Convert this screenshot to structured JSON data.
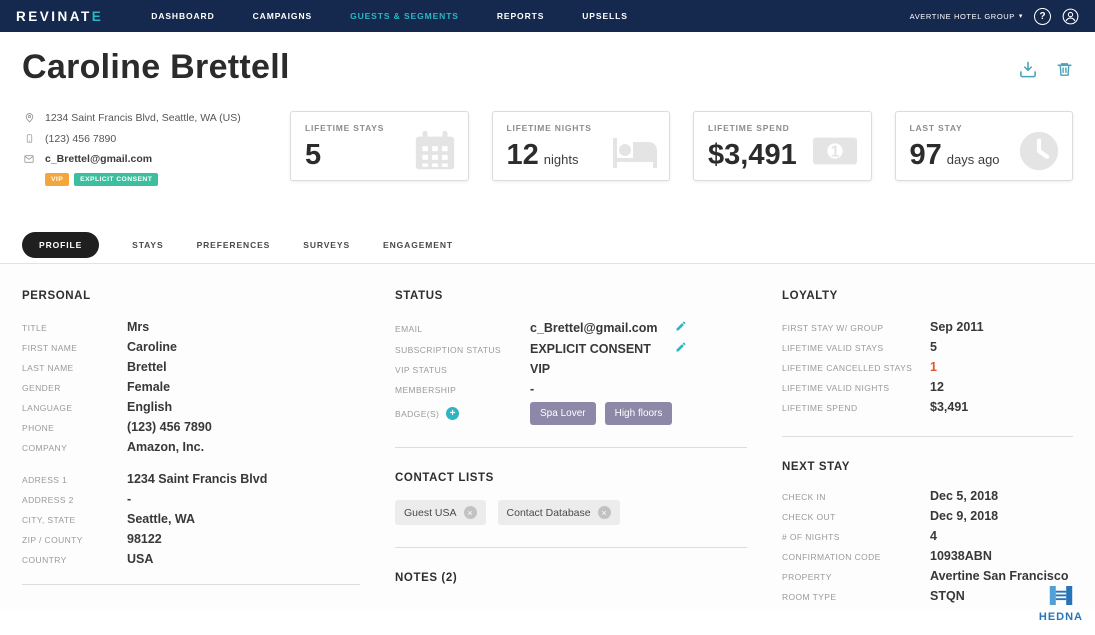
{
  "nav": {
    "logo_main": "REVINAT",
    "logo_accent": "E",
    "items": [
      {
        "label": "DASHBOARD"
      },
      {
        "label": "CAMPAIGNS"
      },
      {
        "label": "GUESTS & SEGMENTS"
      },
      {
        "label": "REPORTS"
      },
      {
        "label": "UPSELLS"
      }
    ],
    "account_label": "AVERTINE HOTEL GROUP",
    "help_icon": "?"
  },
  "header": {
    "title": "Caroline Brettell",
    "address": "1234 Saint Francis Blvd, Seattle, WA (US)",
    "phone": "(123) 456 7890",
    "email": "c_Brettel@gmail.com",
    "vip_badge": "VIP",
    "consent_badge": "EXPLICIT CONSENT"
  },
  "stats": {
    "cards": [
      {
        "label": "LIFETIME STAYS",
        "value": "5",
        "suffix": "",
        "icon": "calendar-icon"
      },
      {
        "label": "LIFETIME NIGHTS",
        "value": "12",
        "suffix": "nights",
        "icon": "bed-icon"
      },
      {
        "label": "LIFETIME SPEND",
        "value": "$3,491",
        "suffix": "",
        "icon": "money-icon"
      },
      {
        "label": "LAST STAY",
        "value": "97",
        "suffix": "days ago",
        "icon": "clock-icon"
      }
    ]
  },
  "tabs": {
    "items": [
      {
        "label": "PROFILE"
      },
      {
        "label": "STAYS"
      },
      {
        "label": "PREFERENCES"
      },
      {
        "label": "SURVEYS"
      },
      {
        "label": "ENGAGEMENT"
      }
    ]
  },
  "personal": {
    "heading": "PERSONAL",
    "rows": [
      {
        "label": "TITLE",
        "value": "Mrs"
      },
      {
        "label": "FIRST NAME",
        "value": "Caroline"
      },
      {
        "label": "LAST NAME",
        "value": "Brettel"
      },
      {
        "label": "GENDER",
        "value": "Female"
      },
      {
        "label": "LANGUAGE",
        "value": "English"
      },
      {
        "label": "PHONE",
        "value": "(123) 456 7890"
      },
      {
        "label": "COMPANY",
        "value": "Amazon, Inc."
      }
    ],
    "address_rows": [
      {
        "label": "ADRESS 1",
        "value": "1234 Saint Francis Blvd"
      },
      {
        "label": "ADDRESS 2",
        "value": "-"
      },
      {
        "label": "CITY, STATE",
        "value": "Seattle, WA"
      },
      {
        "label": "ZIP / COUNTY",
        "value": "98122"
      },
      {
        "label": "COUNTRY",
        "value": "USA"
      }
    ]
  },
  "status": {
    "heading": "STATUS",
    "rows": [
      {
        "label": "EMAIL",
        "value": "c_Brettel@gmail.com"
      },
      {
        "label": "SUBSCRIPTION STATUS",
        "value": "EXPLICIT CONSENT"
      },
      {
        "label": "VIP STATUS",
        "value": "VIP"
      },
      {
        "label": "MEMBERSHIP",
        "value": "-"
      },
      {
        "label": "BADGE(S)",
        "value": ""
      }
    ],
    "badges": [
      {
        "label": "Spa Lover"
      },
      {
        "label": "High floors"
      }
    ]
  },
  "contact_lists": {
    "heading": "CONTACT LISTS",
    "chips": [
      {
        "label": "Guest USA"
      },
      {
        "label": "Contact Database"
      }
    ]
  },
  "notes": {
    "heading": "NOTES (2)"
  },
  "loyalty": {
    "heading": "LOYALTY",
    "rows": [
      {
        "label": "FIRST STAY W/ GROUP",
        "value": "Sep 2011"
      },
      {
        "label": "LIFETIME VALID STAYS",
        "value": "5"
      },
      {
        "label": "LIFETIME CANCELLED STAYS",
        "value": "1"
      },
      {
        "label": "LIFETIME VALID NIGHTS",
        "value": "12"
      },
      {
        "label": "LIFETIME SPEND",
        "value": "$3,491"
      }
    ]
  },
  "next_stay": {
    "heading": "NEXT STAY",
    "rows": [
      {
        "label": "CHECK IN",
        "value": "Dec 5, 2018"
      },
      {
        "label": "CHECK OUT",
        "value": "Dec 9, 2018"
      },
      {
        "label": "# OF NIGHTS",
        "value": "4"
      },
      {
        "label": "CONFIRMATION CODE",
        "value": "10938ABN"
      },
      {
        "label": "PROPERTY",
        "value": "Avertine San Francisco"
      },
      {
        "label": "ROOM TYPE",
        "value": "STQN"
      }
    ]
  },
  "watermark": {
    "text": "HEDNA"
  },
  "colors": {
    "nav_bg": "#15294e",
    "accent_teal": "#2cb5c4",
    "vip_orange": "#f2a63c",
    "consent_green": "#3bbf9e",
    "badge_purple": "#8d87a8",
    "cancelled_red": "#e0552f"
  }
}
